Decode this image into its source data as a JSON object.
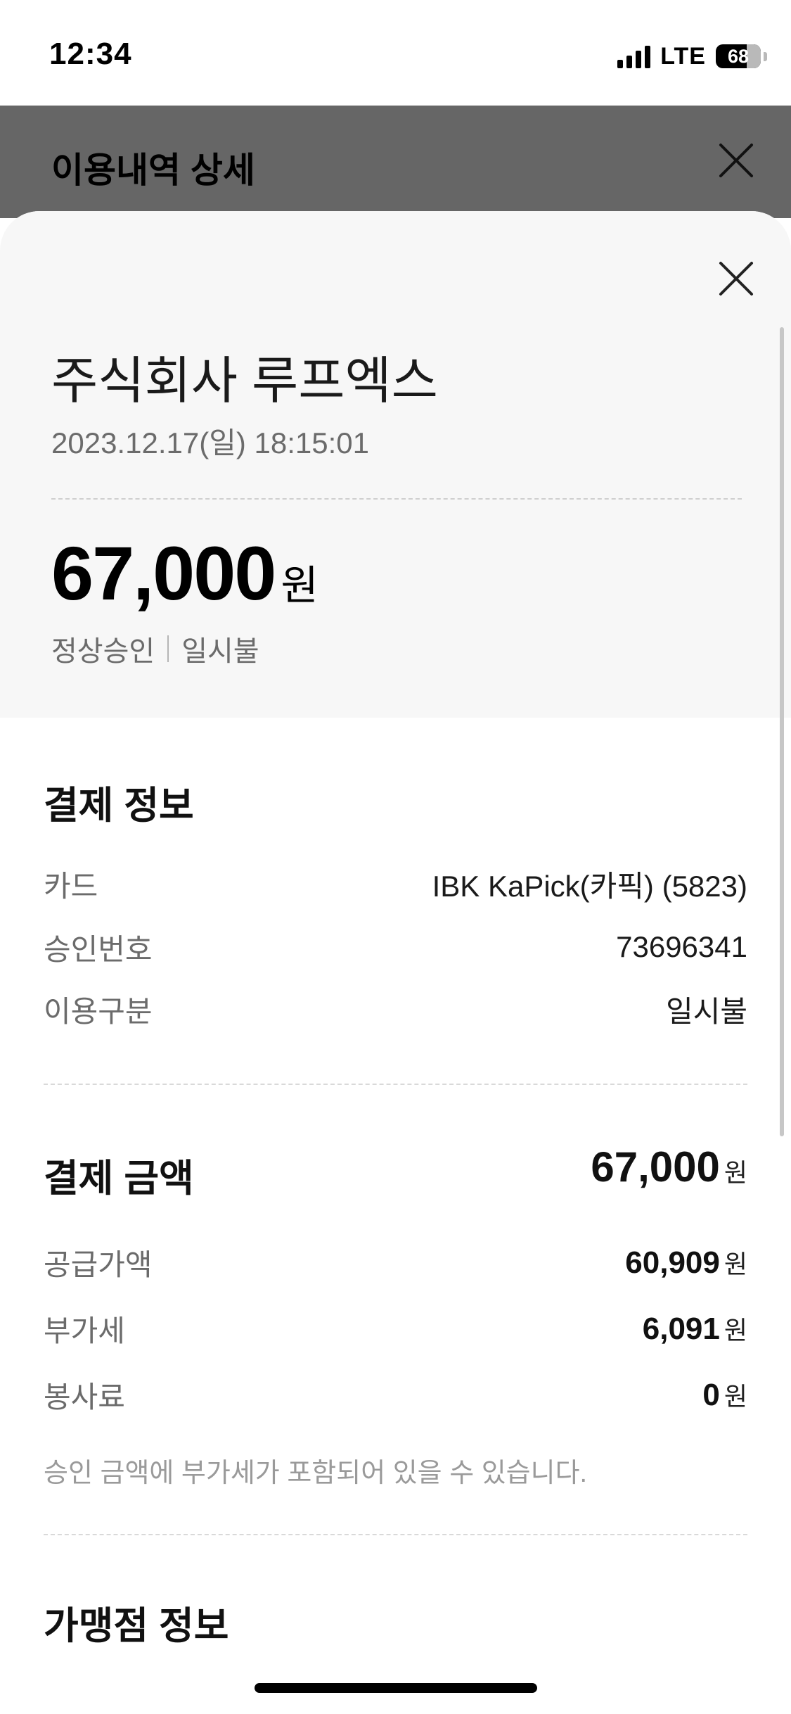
{
  "status_bar": {
    "time": "12:34",
    "network": "LTE",
    "battery": "68"
  },
  "background_header": {
    "title": "이용내역 상세"
  },
  "summary": {
    "merchant_name": "주식회사 루프엑스",
    "datetime": "2023.12.17(일) 18:15:01",
    "amount": "67,000",
    "amount_unit": "원",
    "approval_status": "정상승인",
    "payment_type": "일시불"
  },
  "payment_info": {
    "title": "결제 정보",
    "rows": [
      {
        "label": "카드",
        "value": "IBK KaPick(카픽) (5823)"
      },
      {
        "label": "승인번호",
        "value": "73696341"
      },
      {
        "label": "이용구분",
        "value": "일시불"
      }
    ]
  },
  "payment_amount": {
    "title": "결제 금액",
    "total": "67,000",
    "unit": "원",
    "rows": [
      {
        "label": "공급가액",
        "value": "60,909",
        "unit": "원"
      },
      {
        "label": "부가세",
        "value": "6,091",
        "unit": "원"
      },
      {
        "label": "봉사료",
        "value": "0",
        "unit": "원"
      }
    ],
    "notice": "승인 금액에 부가세가 포함되어 있을 수 있습니다."
  },
  "merchant_info": {
    "title": "가맹점 정보"
  },
  "colors": {
    "overlay_header": "#666666",
    "sheet_top": "#f7f7f7",
    "label_gray": "#6b6b6b",
    "notice_gray": "#9a9a9a"
  }
}
